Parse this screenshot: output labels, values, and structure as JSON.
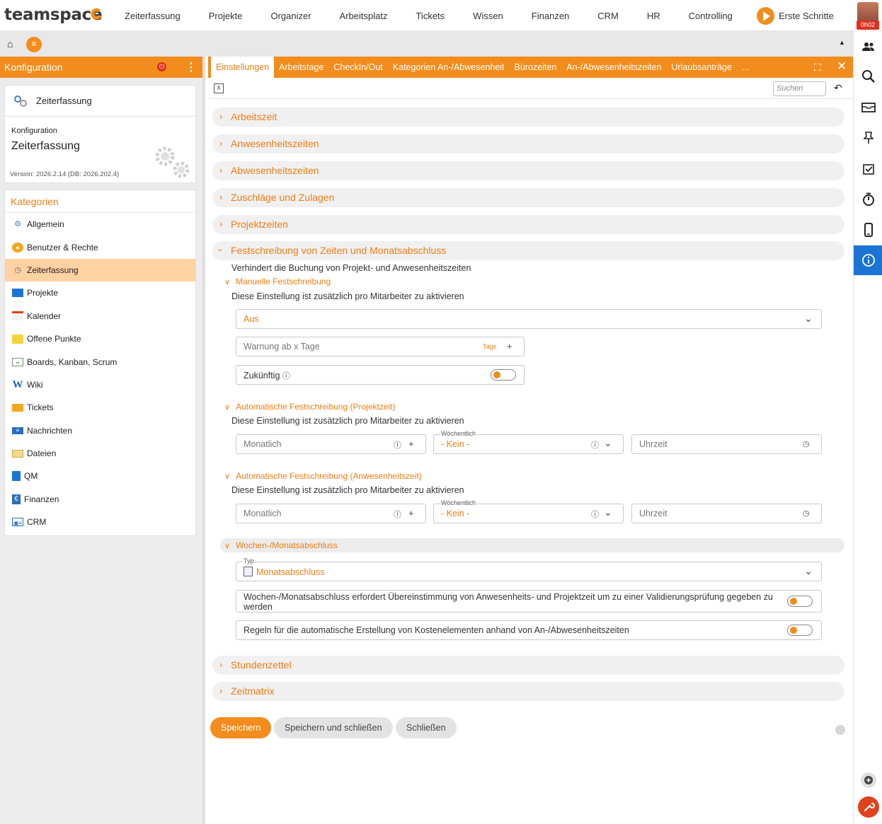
{
  "app": {
    "logo": "teamspace"
  },
  "topnav": [
    "Zeiterfassung",
    "Projekte",
    "Organizer",
    "Arbeitsplatz",
    "Tickets",
    "Wissen",
    "Finanzen",
    "CRM",
    "HR",
    "Controlling"
  ],
  "erste_schritte": "Erste Schritte",
  "user": {
    "timer": "0h02"
  },
  "left": {
    "title": "Konfiguration",
    "module_name": "Zeiterfassung",
    "config_label": "Konfiguration",
    "config_title": "Zeiterfassung",
    "version": "Version: 2026.2.14 (DB: 2026.202.4)",
    "categories_title": "Kategorien",
    "categories": [
      {
        "label": "Allgemein",
        "icon": "gears-icon"
      },
      {
        "label": "Benutzer & Rechte",
        "icon": "users-icon"
      },
      {
        "label": "Zeiterfassung",
        "icon": "stopwatch-icon"
      },
      {
        "label": "Projekte",
        "icon": "folder-icon"
      },
      {
        "label": "Kalender",
        "icon": "calendar-icon"
      },
      {
        "label": "Offene Punkte",
        "icon": "note-icon"
      },
      {
        "label": "Boards, Kanban, Scrum",
        "icon": "board-icon"
      },
      {
        "label": "Wiki",
        "icon": "wiki-icon"
      },
      {
        "label": "Tickets",
        "icon": "ticket-icon"
      },
      {
        "label": "Nachrichten",
        "icon": "messages-icon"
      },
      {
        "label": "Dateien",
        "icon": "files-icon"
      },
      {
        "label": "QM",
        "icon": "qm-icon"
      },
      {
        "label": "Finanzen",
        "icon": "euro-icon"
      },
      {
        "label": "CRM",
        "icon": "crm-icon"
      }
    ]
  },
  "tabs": [
    "Einstellungen",
    "Arbeitstage",
    "CheckIn/Out",
    "Kategorien An-/Abwesenheit",
    "Bürozeiten",
    "An-/Abwesenheitszeiten",
    "Urlaubsanträge",
    "..."
  ],
  "search_placeholder": "Suchen",
  "sections": {
    "arbeitszeit": "Arbeitszeit",
    "anwesenheitszeiten": "Anwesenheitszeiten",
    "abwesenheitszeiten": "Abwesenheitszeiten",
    "zuschlaege": "Zuschläge und Zulagen",
    "projektzeiten": "Projektzeiten",
    "festschreibung": "Festschreibung von Zeiten und Monatsabschluss",
    "stundenzettel": "Stundenzettel",
    "zeitmatrix": "Zeitmatrix"
  },
  "fest": {
    "desc": "Verhindert die Buchung von Projekt- und Anwesenheitszeiten",
    "manual_title": "Manuelle Festschreibung",
    "manual_desc": "Diese Einstellung ist zusätzlich pro Mitarbeiter zu aktivieren",
    "manual_select": "Aus",
    "warn_placeholder": "Warnung ab x Tage",
    "warn_unit": "Tage",
    "future_label": "Zukünftig",
    "auto_proj_title": "Automatische Festschreibung (Projektzeit)",
    "auto_proj_desc": "Diese Einstellung ist zusätzlich pro Mitarbeiter zu aktivieren",
    "auto_anw_title": "Automatische Festschreibung (Anwesenheitszeit)",
    "auto_anw_desc": "Diese Einstellung ist zusätzlich pro Mitarbeiter zu aktivieren",
    "monthly_placeholder": "Monatlich",
    "weekly_label": "Wöchentlich",
    "weekly_value": "- Kein -",
    "time_placeholder": "Uhrzeit",
    "closing_title": "Wochen-/Monatsabschluss",
    "type_label": "Typ",
    "type_value": "Monatsabschluss",
    "opt1": "Wochen-/Monatsabschluss erfordert Übereinstimmung von Anwesenheits- und Projektzeit um zu einer Validierungsprüfung gegeben zu werden",
    "opt2": "Regeln für die automatische Erstellung von Kostenelementen anhand von An-/Abwesenheitszeiten"
  },
  "buttons": {
    "save": "Speichern",
    "save_close": "Speichern und schließen",
    "close": "Schließen"
  },
  "colors": {
    "accent": "#f28c1c",
    "accent_text": "#f07d14",
    "selected": "#ffd1a3",
    "info_active": "#1b73d4"
  }
}
